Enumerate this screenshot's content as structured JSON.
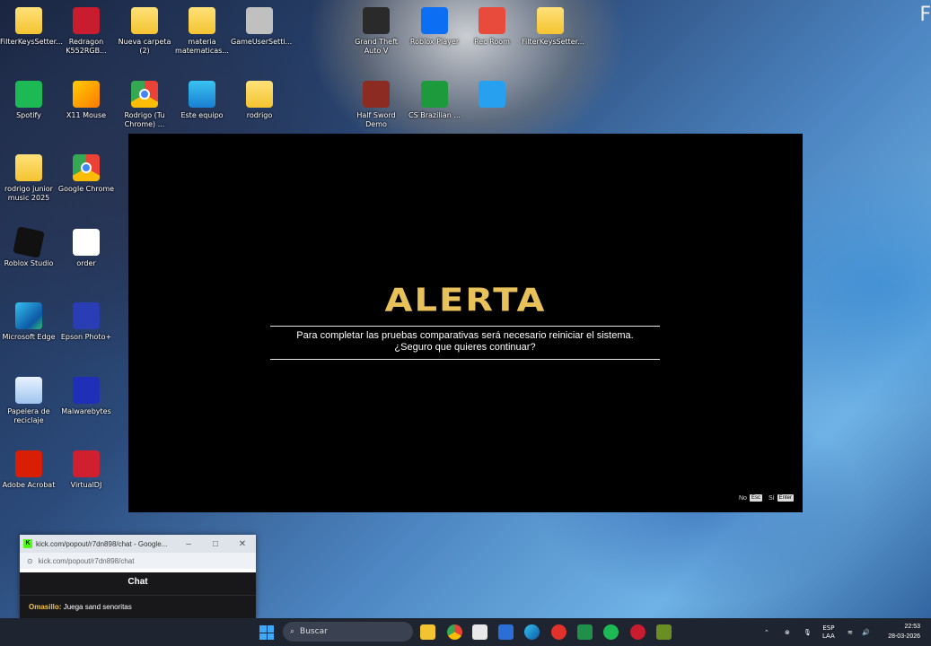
{
  "desktop": {
    "icons": [
      {
        "label": "FilterKeysSetter...",
        "kind": "folder"
      },
      {
        "label": "Redragon K552RGB...",
        "kind": "redragon"
      },
      {
        "label": "Nueva carpeta (2)",
        "kind": "folder"
      },
      {
        "label": "materia matematicas...",
        "kind": "folder"
      },
      {
        "label": "GameUserSetti...",
        "kind": "gen"
      },
      {
        "label": "Grand Theft Auto V",
        "kind": "gta"
      },
      {
        "label": "Roblox Player",
        "kind": "roblox2"
      },
      {
        "label": "Rec Room",
        "kind": "recroom"
      },
      {
        "label": "FilterKeysSetter...",
        "kind": "folder"
      },
      {
        "label": "Spotify",
        "kind": "spotify"
      },
      {
        "label": "X11 Mouse",
        "kind": "x11"
      },
      {
        "label": "Rodrigo (Tu Chrome) ...",
        "kind": "chrome"
      },
      {
        "label": "Este equipo",
        "kind": "monitor"
      },
      {
        "label": "rodrigo",
        "kind": "folder"
      },
      {
        "label": "Half Sword Demo",
        "kind": "half"
      },
      {
        "label": "CS Brazilian ...",
        "kind": "cs"
      },
      {
        "label": "",
        "kind": "fort"
      },
      {
        "label": "rodrigo junior music 2025",
        "kind": "folder"
      },
      {
        "label": "Google Chrome",
        "kind": "chrome"
      },
      {
        "label": "Roblox Studio",
        "kind": "roblox"
      },
      {
        "label": "order",
        "kind": "file"
      },
      {
        "label": "Microsoft Edge",
        "kind": "edge"
      },
      {
        "label": "Epson Photo+",
        "kind": "epson"
      },
      {
        "label": "Papelera de reciclaje",
        "kind": "recycle"
      },
      {
        "label": "Malwarebytes",
        "kind": "malware"
      },
      {
        "label": "Adobe Acrobat",
        "kind": "acrobat"
      },
      {
        "label": "VirtualDJ",
        "kind": "vdj"
      }
    ],
    "corner_letter": "F"
  },
  "game": {
    "title": "ALERTA",
    "message_line1": "Para completar las pruebas comparativas será necesario reiniciar el sistema.",
    "message_line2": "¿Seguro que quieres continuar?",
    "prompt_no": "No",
    "prompt_no_key": "Esc",
    "prompt_yes": "Sí",
    "prompt_yes_key": "Enter"
  },
  "popup": {
    "title": "kick.com/popout/r7dn898/chat - Google...",
    "url": "kick.com/popout/r7dn898/chat",
    "chat_header": "Chat",
    "message_user": "Omasillo:",
    "message_text": "Juega sand senoritas"
  },
  "taskbar": {
    "search_placeholder": "Buscar",
    "language": "ESP",
    "language_sub": "LAA",
    "time": "22:53",
    "date": "28-03-2026"
  }
}
